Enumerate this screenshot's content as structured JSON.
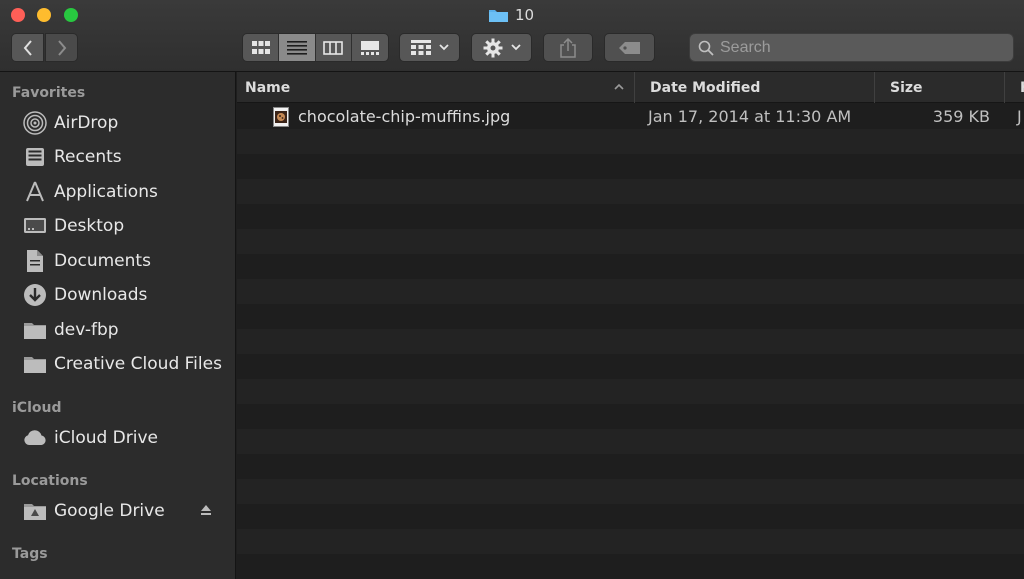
{
  "window": {
    "title": "10"
  },
  "toolbar": {
    "search_placeholder": "Search"
  },
  "sidebar": {
    "sections": {
      "favorites": "Favorites",
      "icloud": "iCloud",
      "locations": "Locations",
      "tags": "Tags"
    },
    "favorites": [
      {
        "label": "AirDrop",
        "icon": "airdrop-icon"
      },
      {
        "label": "Recents",
        "icon": "recents-icon"
      },
      {
        "label": "Applications",
        "icon": "applications-icon"
      },
      {
        "label": "Desktop",
        "icon": "desktop-icon"
      },
      {
        "label": "Documents",
        "icon": "documents-icon"
      },
      {
        "label": "Downloads",
        "icon": "downloads-icon"
      },
      {
        "label": "dev-fbp",
        "icon": "folder-icon"
      },
      {
        "label": "Creative Cloud Files",
        "icon": "folder-icon"
      }
    ],
    "icloud": [
      {
        "label": "iCloud Drive",
        "icon": "cloud-icon"
      }
    ],
    "locations": [
      {
        "label": "Google Drive",
        "icon": "drive-icon"
      }
    ]
  },
  "list": {
    "columns": {
      "name": "Name",
      "date": "Date Modified",
      "size": "Size",
      "kind": "K"
    },
    "files": [
      {
        "name": "chocolate-chip-muffins.jpg",
        "date": "Jan 17, 2014 at 11:30 AM",
        "size": "359 KB",
        "kind": "J"
      }
    ]
  },
  "colors": {
    "folder_blue": "#5ab0ea",
    "close": "#fe5f57",
    "minimize": "#febc2e",
    "maximize": "#28c840"
  }
}
